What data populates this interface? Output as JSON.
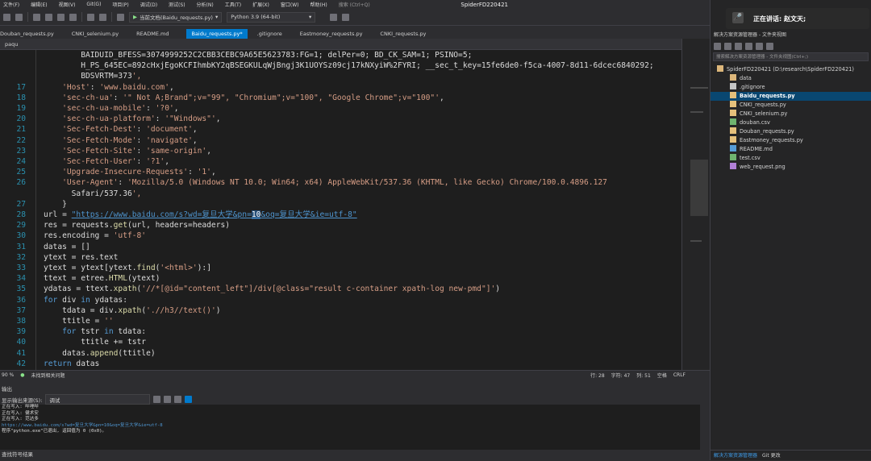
{
  "menubar": {
    "items": [
      "文件(F)",
      "编辑(E)",
      "视图(V)",
      "Git(G)",
      "项目(P)",
      "调试(D)",
      "测试(S)",
      "分析(N)",
      "工具(T)",
      "扩展(X)",
      "窗口(W)",
      "帮助(H)"
    ],
    "search_hint": "搜索 (Ctrl+Q)",
    "title": "SpiderFD220421"
  },
  "toolbar": {
    "current_doc": "当前文档(Baidu_requests.py)",
    "python_env": "Python 3.9 (64-bit)"
  },
  "tabs": [
    "Douban_requests.py",
    "CNKI_selenium.py",
    "README.md",
    "Baidu_requests.py*",
    ".gitignore",
    "Eastmoney_requests.py",
    "CNKI_requests.py"
  ],
  "nav": {
    "scope": "paqu"
  },
  "editor": {
    "lines": [
      {
        "n": "",
        "code": "        BAIDUID_BFESS=3074999252C2CBB3CEBC9A65E5623783:FG=1; delPer=0; BD_CK_SAM=1; PSINO=5;"
      },
      {
        "n": "",
        "code": "        H_PS_645EC=892cHxjEgoKCFIhmbKY2qBSEGKULqWjBngj3K1UOYSz09cj17kNXyiW%2FYRI; __sec_t_key=15fe6de0-f5ca-4007-8d11-6dcec6840292;"
      },
      {
        "n": "",
        "code": "        BDSVRTM=373',"
      },
      {
        "n": "17",
        "code": "    'Host': 'www.baidu.com',"
      },
      {
        "n": "18",
        "code": "    'sec-ch-ua': '\" Not A;Brand\";v=\"99\", \"Chromium\";v=\"100\", \"Google Chrome\";v=\"100\"',"
      },
      {
        "n": "19",
        "code": "    'sec-ch-ua-mobile': '?0',"
      },
      {
        "n": "20",
        "code": "    'sec-ch-ua-platform': '\"Windows\"',"
      },
      {
        "n": "21",
        "code": "    'Sec-Fetch-Dest': 'document',"
      },
      {
        "n": "22",
        "code": "    'Sec-Fetch-Mode': 'navigate',"
      },
      {
        "n": "23",
        "code": "    'Sec-Fetch-Site': 'same-origin',"
      },
      {
        "n": "24",
        "code": "    'Sec-Fetch-User': '?1',"
      },
      {
        "n": "25",
        "code": "    'Upgrade-Insecure-Requests': '1',"
      },
      {
        "n": "26",
        "code": "    'User-Agent': 'Mozilla/5.0 (Windows NT 10.0; Win64; x64) AppleWebKit/537.36 (KHTML, like Gecko) Chrome/100.0.4896.127"
      },
      {
        "n": "",
        "code": "      Safari/537.36',"
      },
      {
        "n": "27",
        "code": "    }"
      },
      {
        "n": "28",
        "code": "url = \"https://www.baidu.com/s?wd=复旦大学&pn=10&oq=复旦大学&ie=utf-8\""
      },
      {
        "n": "29",
        "code": "res = requests.get(url, headers=headers)"
      },
      {
        "n": "30",
        "code": "res.encoding = 'utf-8'"
      },
      {
        "n": "31",
        "code": "datas = []"
      },
      {
        "n": "32",
        "code": "ytext = res.text"
      },
      {
        "n": "33",
        "code": "ytext = ytext[ytext.find('<html>'):]"
      },
      {
        "n": "34",
        "code": "ttext = etree.HTML(ytext)"
      },
      {
        "n": "35",
        "code": "ydatas = ttext.xpath('//*[@id=\"content_left\"]/div[@class=\"result c-container xpath-log new-pmd\"]')"
      },
      {
        "n": "36",
        "code": "for div in ydatas:"
      },
      {
        "n": "37",
        "code": "    tdata = div.xpath('.//h3//text()')"
      },
      {
        "n": "38",
        "code": "    ttitle = ''"
      },
      {
        "n": "39",
        "code": "    for tstr in tdata:"
      },
      {
        "n": "40",
        "code": "        ttitle += tstr"
      },
      {
        "n": "41",
        "code": "    datas.append(ttitle)"
      },
      {
        "n": "42",
        "code": "return datas"
      }
    ]
  },
  "status": {
    "zoom": "90 %",
    "issues": "未找到相关问题",
    "row": "行: 28",
    "char": "字符: 47",
    "col": "列: 51",
    "tab_mode": "空格",
    "eol": "CRLF"
  },
  "output": {
    "title": "输出",
    "source_label": "显示输出来源(S):",
    "source_value": "调试",
    "lines": [
      "正在写入:          哔哩哔",
      "正在写入:          健术安",
      "正在写入:          范达多",
      "https://www.baidu.com/s?wd=复旦大学&pn=10&oq=复旦大学&ie=utf-8",
      "程序\"python.exe\"已退出, 返回值为 0 (0x0)。"
    ],
    "bottom_tab": "查找符号结果"
  },
  "right": {
    "speaker": "正在讲话: 赵文天;",
    "se_title": "解决方案资源管理器 - 文件夹视图",
    "se_search": "搜索解决方案资源管理器 - 文件夹视图(Ctrl+;)",
    "tree": [
      {
        "label": "SpiderFD220421 (D:\\research\\SpiderFD220421)",
        "indent": 0,
        "icon": "folder-icon"
      },
      {
        "label": "data",
        "indent": 1,
        "icon": "folder-icon"
      },
      {
        "label": ".gitignore",
        "indent": 1,
        "icon": "file-icon"
      },
      {
        "label": "Baidu_requests.py",
        "indent": 1,
        "icon": "python-file-icon",
        "selected": true
      },
      {
        "label": "CNKI_requests.py",
        "indent": 1,
        "icon": "python-file-icon"
      },
      {
        "label": "CNKI_selenium.py",
        "indent": 1,
        "icon": "python-file-icon"
      },
      {
        "label": "douban.csv",
        "indent": 1,
        "icon": "csv-file-icon"
      },
      {
        "label": "Douban_requests.py",
        "indent": 1,
        "icon": "python-file-icon"
      },
      {
        "label": "Eastmoney_requests.py",
        "indent": 1,
        "icon": "python-file-icon"
      },
      {
        "label": "README.md",
        "indent": 1,
        "icon": "markdown-file-icon"
      },
      {
        "label": "test.csv",
        "indent": 1,
        "icon": "csv-file-icon"
      },
      {
        "label": "web_request.png",
        "indent": 1,
        "icon": "image-file-icon"
      }
    ],
    "bottom_tabs": [
      "解决方案资源管理器",
      "Git 更改"
    ]
  },
  "colors": {
    "accent": "#007acc",
    "editor_bg": "#1e1e1e",
    "string": "#d69d85",
    "keyword": "#569cd6",
    "linenum": "#2b91af"
  }
}
